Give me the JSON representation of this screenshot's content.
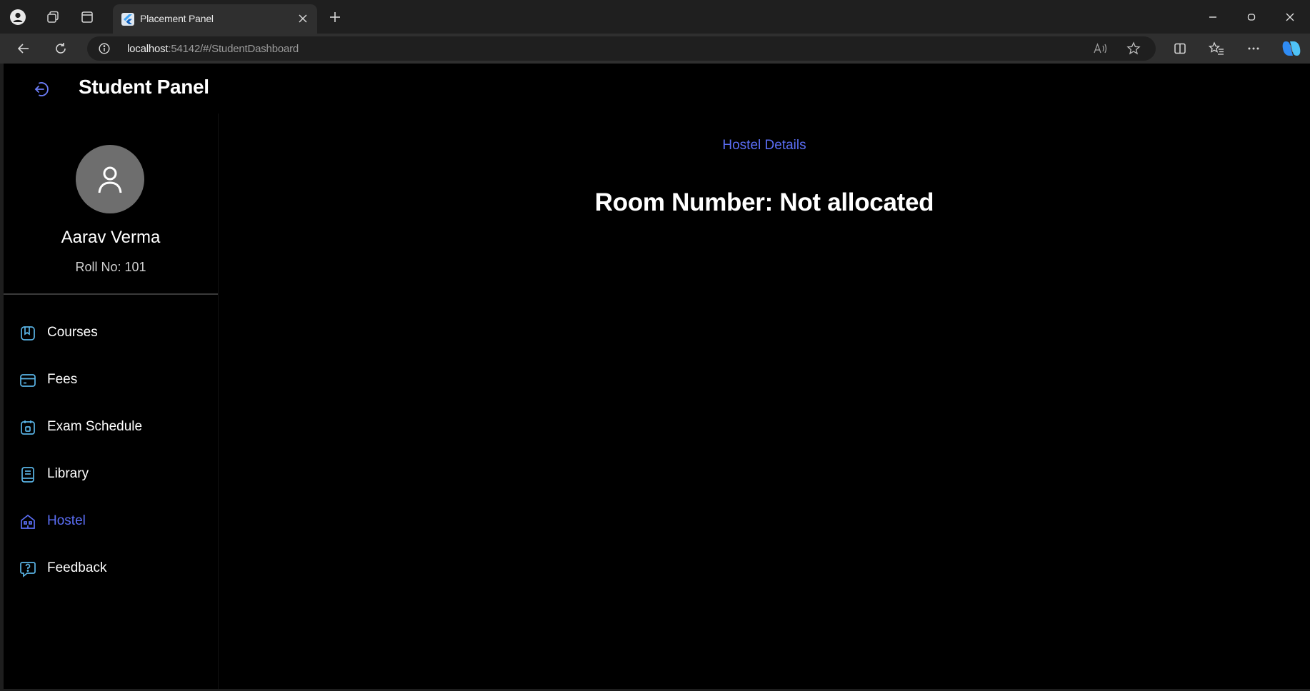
{
  "browser": {
    "tab": {
      "title": "Placement Panel",
      "favicon": "flutter-icon"
    },
    "address_bar": {
      "host": "localhost",
      "path": ":54142/#/StudentDashboard"
    },
    "icons": {
      "profile": "profile-icon",
      "workspaces": "workspaces-icon",
      "tab_actions": "tab-actions-icon",
      "back": "back-arrow-icon",
      "refresh": "refresh-icon",
      "site_info": "info-icon",
      "read_aloud": "read-aloud-icon",
      "favorite": "star-icon",
      "split_screen": "split-screen-icon",
      "favorites": "favorites-icon",
      "menu": "more-icon",
      "copilot": "copilot-icon"
    }
  },
  "app": {
    "title": "Student Panel",
    "logout_icon": "logout-icon",
    "accent_color": "#5b6ef5",
    "background": "#000000"
  },
  "profile": {
    "avatar_icon": "person-icon",
    "name": "Aarav Verma",
    "roll": "Roll No: 101"
  },
  "nav": {
    "items": [
      {
        "label": "Courses",
        "icon": "book-icon",
        "active": false
      },
      {
        "label": "Fees",
        "icon": "payment-icon",
        "active": false
      },
      {
        "label": "Exam Schedule",
        "icon": "exam-schedule-icon",
        "active": false
      },
      {
        "label": "Library",
        "icon": "library-icon",
        "active": false
      },
      {
        "label": "Hostel",
        "icon": "hostel-icon",
        "active": true
      },
      {
        "label": "Feedback",
        "icon": "feedback-icon",
        "active": false
      }
    ]
  },
  "main": {
    "section_title": "Hostel Details",
    "room_info": "Room Number: Not allocated"
  }
}
